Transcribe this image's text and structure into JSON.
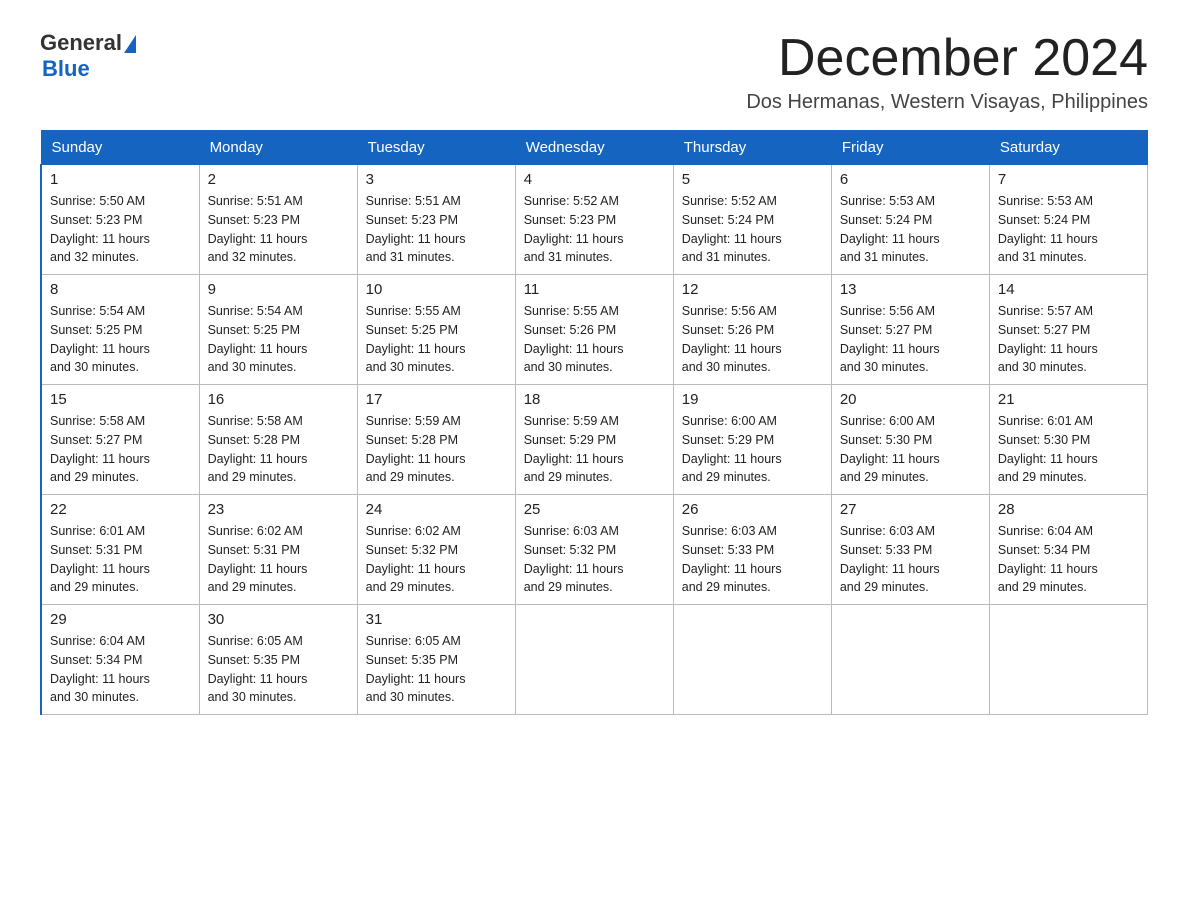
{
  "header": {
    "logo_general": "General",
    "logo_blue": "Blue",
    "title": "December 2024",
    "subtitle": "Dos Hermanas, Western Visayas, Philippines"
  },
  "weekdays": [
    "Sunday",
    "Monday",
    "Tuesday",
    "Wednesday",
    "Thursday",
    "Friday",
    "Saturday"
  ],
  "weeks": [
    [
      {
        "day": "1",
        "sunrise": "5:50 AM",
        "sunset": "5:23 PM",
        "daylight": "11 hours and 32 minutes."
      },
      {
        "day": "2",
        "sunrise": "5:51 AM",
        "sunset": "5:23 PM",
        "daylight": "11 hours and 32 minutes."
      },
      {
        "day": "3",
        "sunrise": "5:51 AM",
        "sunset": "5:23 PM",
        "daylight": "11 hours and 31 minutes."
      },
      {
        "day": "4",
        "sunrise": "5:52 AM",
        "sunset": "5:23 PM",
        "daylight": "11 hours and 31 minutes."
      },
      {
        "day": "5",
        "sunrise": "5:52 AM",
        "sunset": "5:24 PM",
        "daylight": "11 hours and 31 minutes."
      },
      {
        "day": "6",
        "sunrise": "5:53 AM",
        "sunset": "5:24 PM",
        "daylight": "11 hours and 31 minutes."
      },
      {
        "day": "7",
        "sunrise": "5:53 AM",
        "sunset": "5:24 PM",
        "daylight": "11 hours and 31 minutes."
      }
    ],
    [
      {
        "day": "8",
        "sunrise": "5:54 AM",
        "sunset": "5:25 PM",
        "daylight": "11 hours and 30 minutes."
      },
      {
        "day": "9",
        "sunrise": "5:54 AM",
        "sunset": "5:25 PM",
        "daylight": "11 hours and 30 minutes."
      },
      {
        "day": "10",
        "sunrise": "5:55 AM",
        "sunset": "5:25 PM",
        "daylight": "11 hours and 30 minutes."
      },
      {
        "day": "11",
        "sunrise": "5:55 AM",
        "sunset": "5:26 PM",
        "daylight": "11 hours and 30 minutes."
      },
      {
        "day": "12",
        "sunrise": "5:56 AM",
        "sunset": "5:26 PM",
        "daylight": "11 hours and 30 minutes."
      },
      {
        "day": "13",
        "sunrise": "5:56 AM",
        "sunset": "5:27 PM",
        "daylight": "11 hours and 30 minutes."
      },
      {
        "day": "14",
        "sunrise": "5:57 AM",
        "sunset": "5:27 PM",
        "daylight": "11 hours and 30 minutes."
      }
    ],
    [
      {
        "day": "15",
        "sunrise": "5:58 AM",
        "sunset": "5:27 PM",
        "daylight": "11 hours and 29 minutes."
      },
      {
        "day": "16",
        "sunrise": "5:58 AM",
        "sunset": "5:28 PM",
        "daylight": "11 hours and 29 minutes."
      },
      {
        "day": "17",
        "sunrise": "5:59 AM",
        "sunset": "5:28 PM",
        "daylight": "11 hours and 29 minutes."
      },
      {
        "day": "18",
        "sunrise": "5:59 AM",
        "sunset": "5:29 PM",
        "daylight": "11 hours and 29 minutes."
      },
      {
        "day": "19",
        "sunrise": "6:00 AM",
        "sunset": "5:29 PM",
        "daylight": "11 hours and 29 minutes."
      },
      {
        "day": "20",
        "sunrise": "6:00 AM",
        "sunset": "5:30 PM",
        "daylight": "11 hours and 29 minutes."
      },
      {
        "day": "21",
        "sunrise": "6:01 AM",
        "sunset": "5:30 PM",
        "daylight": "11 hours and 29 minutes."
      }
    ],
    [
      {
        "day": "22",
        "sunrise": "6:01 AM",
        "sunset": "5:31 PM",
        "daylight": "11 hours and 29 minutes."
      },
      {
        "day": "23",
        "sunrise": "6:02 AM",
        "sunset": "5:31 PM",
        "daylight": "11 hours and 29 minutes."
      },
      {
        "day": "24",
        "sunrise": "6:02 AM",
        "sunset": "5:32 PM",
        "daylight": "11 hours and 29 minutes."
      },
      {
        "day": "25",
        "sunrise": "6:03 AM",
        "sunset": "5:32 PM",
        "daylight": "11 hours and 29 minutes."
      },
      {
        "day": "26",
        "sunrise": "6:03 AM",
        "sunset": "5:33 PM",
        "daylight": "11 hours and 29 minutes."
      },
      {
        "day": "27",
        "sunrise": "6:03 AM",
        "sunset": "5:33 PM",
        "daylight": "11 hours and 29 minutes."
      },
      {
        "day": "28",
        "sunrise": "6:04 AM",
        "sunset": "5:34 PM",
        "daylight": "11 hours and 29 minutes."
      }
    ],
    [
      {
        "day": "29",
        "sunrise": "6:04 AM",
        "sunset": "5:34 PM",
        "daylight": "11 hours and 30 minutes."
      },
      {
        "day": "30",
        "sunrise": "6:05 AM",
        "sunset": "5:35 PM",
        "daylight": "11 hours and 30 minutes."
      },
      {
        "day": "31",
        "sunrise": "6:05 AM",
        "sunset": "5:35 PM",
        "daylight": "11 hours and 30 minutes."
      },
      null,
      null,
      null,
      null
    ]
  ],
  "labels": {
    "sunrise": "Sunrise:",
    "sunset": "Sunset:",
    "daylight": "Daylight:"
  },
  "accent_color": "#1565c0"
}
